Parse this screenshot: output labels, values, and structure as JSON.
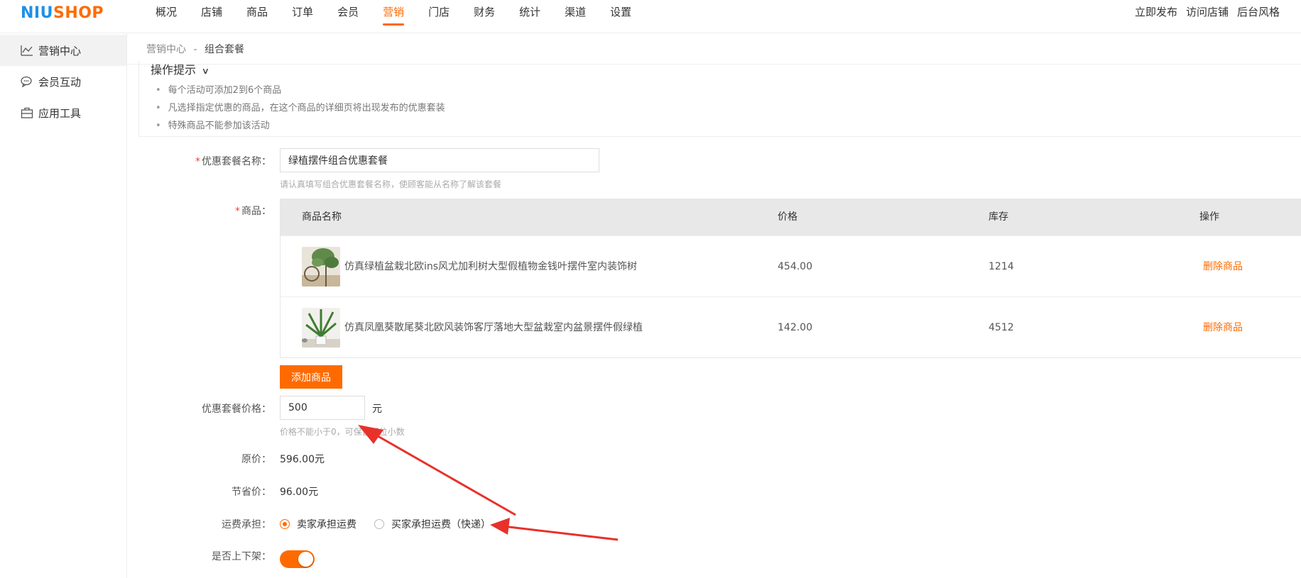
{
  "brand": {
    "logo_a": "NIU",
    "logo_b": "SHOP"
  },
  "nav": {
    "items": [
      {
        "label": "概况"
      },
      {
        "label": "店铺"
      },
      {
        "label": "商品"
      },
      {
        "label": "订单"
      },
      {
        "label": "会员"
      },
      {
        "label": "营销",
        "active": true
      },
      {
        "label": "门店"
      },
      {
        "label": "财务"
      },
      {
        "label": "统计"
      },
      {
        "label": "渠道"
      },
      {
        "label": "设置"
      }
    ],
    "right": [
      "立即发布",
      "访问店铺",
      "后台风格"
    ]
  },
  "sidebar": {
    "items": [
      {
        "label": "营销中心",
        "icon": "chart-icon"
      },
      {
        "label": "会员互动",
        "icon": "chat-icon"
      },
      {
        "label": "应用工具",
        "icon": "toolbox-icon"
      }
    ]
  },
  "breadcrumb": {
    "parent": "营销中心",
    "sep": "-",
    "current": "组合套餐"
  },
  "tips": {
    "title": "操作提示",
    "items": [
      "每个活动可添加2到6个商品",
      "凡选择指定优惠的商品，在这个商品的详细页将出现发布的优惠套装",
      "特殊商品不能参加该活动"
    ]
  },
  "form": {
    "name_label": "优惠套餐名称：",
    "name_value": "绿植摆件组合优惠套餐",
    "name_hint": "请认真填写组合优惠套餐名称，使顾客能从名称了解该套餐",
    "goods_label": "商品：",
    "table_headers": {
      "name": "商品名称",
      "price": "价格",
      "stock": "库存",
      "action": "操作"
    },
    "goods": [
      {
        "name": "仿真绿植盆栽北欧ins风尤加利树大型假植物金钱叶摆件室内装饰树",
        "price": "454.00",
        "stock": "1214",
        "action": "删除商品"
      },
      {
        "name": "仿真凤凰葵散尾葵北欧风装饰客厅落地大型盆栽室内盆景摆件假绿植",
        "price": "142.00",
        "stock": "4512",
        "action": "删除商品"
      }
    ],
    "add_goods_label": "添加商品",
    "price_label": "优惠套餐价格：",
    "price_value": "500",
    "price_unit": "元",
    "price_hint": "价格不能小于0，可保留两位小数",
    "original_label": "原价：",
    "original_value": "596.00元",
    "save_label": "节省价：",
    "save_value": "96.00元",
    "shipping_label": "运费承担：",
    "shipping_options": [
      "卖家承担运费",
      "买家承担运费（快递）"
    ],
    "shipping_selected": 0,
    "onsale_label": "是否上下架：",
    "onsale_on": true
  },
  "colors": {
    "accent": "#ff6a00",
    "brand_blue": "#1e90e8",
    "arrow": "#e8312a"
  }
}
